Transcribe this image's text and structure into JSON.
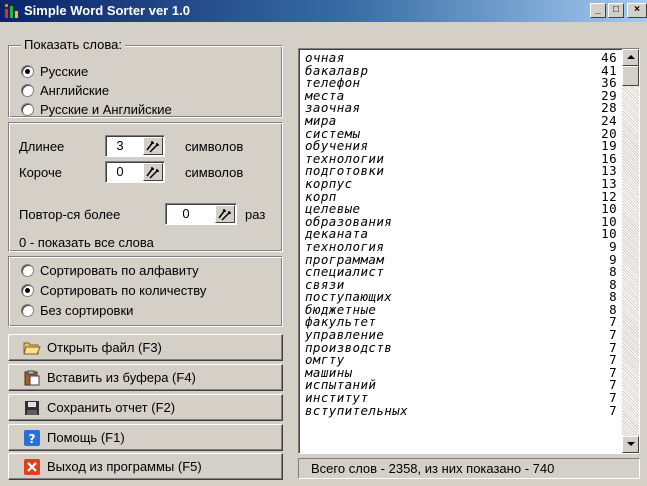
{
  "window": {
    "title": "Simple Word Sorter  ver 1.0",
    "controls": {
      "minimize": "_",
      "maximize": "□",
      "close": "×"
    }
  },
  "show_words": {
    "legend": "Показать слова:",
    "options": [
      {
        "label": "Русские",
        "selected": true
      },
      {
        "label": "Английские",
        "selected": false
      },
      {
        "label": "Русские и Английские",
        "selected": false
      }
    ]
  },
  "length": {
    "longer_label": "Длинее",
    "longer_value": "3",
    "shorter_label": "Короче",
    "shorter_value": "0",
    "units": "символов",
    "repeat_label": "Повтор-ся более",
    "repeat_value": "0",
    "repeat_units": "раз",
    "hint": "0 - показать все слова"
  },
  "sort": {
    "options": [
      {
        "label": "Сортировать по алфавиту",
        "selected": false
      },
      {
        "label": "Сортировать по количеству",
        "selected": true
      },
      {
        "label": "Без сортировки",
        "selected": false
      }
    ]
  },
  "buttons": {
    "open": "Открыть файл  (F3)",
    "paste": "Вставить из буфера  (F4)",
    "save": "Сохранить отчет (F2)",
    "help": "Помощь  (F1)",
    "exit": "Выход из программы  (F5)"
  },
  "icons": {
    "app": "chart-bars-icon",
    "open": "folder-open-icon",
    "paste": "clipboard-icon",
    "save": "floppy-disk-icon",
    "help": "help-question-icon",
    "exit": "close-x-icon"
  },
  "colors": {
    "title_bar": "#0a246a",
    "help_icon": "#2a6fd6",
    "exit_icon": "#e04020"
  },
  "words": [
    {
      "word": "очная",
      "count": "46"
    },
    {
      "word": "бакалавр",
      "count": "41"
    },
    {
      "word": "телефон",
      "count": "36"
    },
    {
      "word": "места",
      "count": "29"
    },
    {
      "word": "заочная",
      "count": "28"
    },
    {
      "word": "мира",
      "count": "24"
    },
    {
      "word": "системы",
      "count": "20"
    },
    {
      "word": "обучения",
      "count": "19"
    },
    {
      "word": "технологии",
      "count": "16"
    },
    {
      "word": "подготовки",
      "count": "13"
    },
    {
      "word": "корпус",
      "count": "13"
    },
    {
      "word": "корп",
      "count": "12"
    },
    {
      "word": "целевые",
      "count": "10"
    },
    {
      "word": "образования",
      "count": "10"
    },
    {
      "word": "деканата",
      "count": "10"
    },
    {
      "word": "технология",
      "count": "9"
    },
    {
      "word": "программам",
      "count": "9"
    },
    {
      "word": "специалист",
      "count": "8"
    },
    {
      "word": "связи",
      "count": "8"
    },
    {
      "word": "поступающих",
      "count": "8"
    },
    {
      "word": "бюджетные",
      "count": "8"
    },
    {
      "word": "факультет",
      "count": "7"
    },
    {
      "word": "управление",
      "count": "7"
    },
    {
      "word": "производств",
      "count": "7"
    },
    {
      "word": "омгту",
      "count": "7"
    },
    {
      "word": "машины",
      "count": "7"
    },
    {
      "word": "испытаний",
      "count": "7"
    },
    {
      "word": "институт",
      "count": "7"
    },
    {
      "word": "вступительных",
      "count": "7"
    }
  ],
  "status": "Всего слов - 2358, из них показано - 740"
}
